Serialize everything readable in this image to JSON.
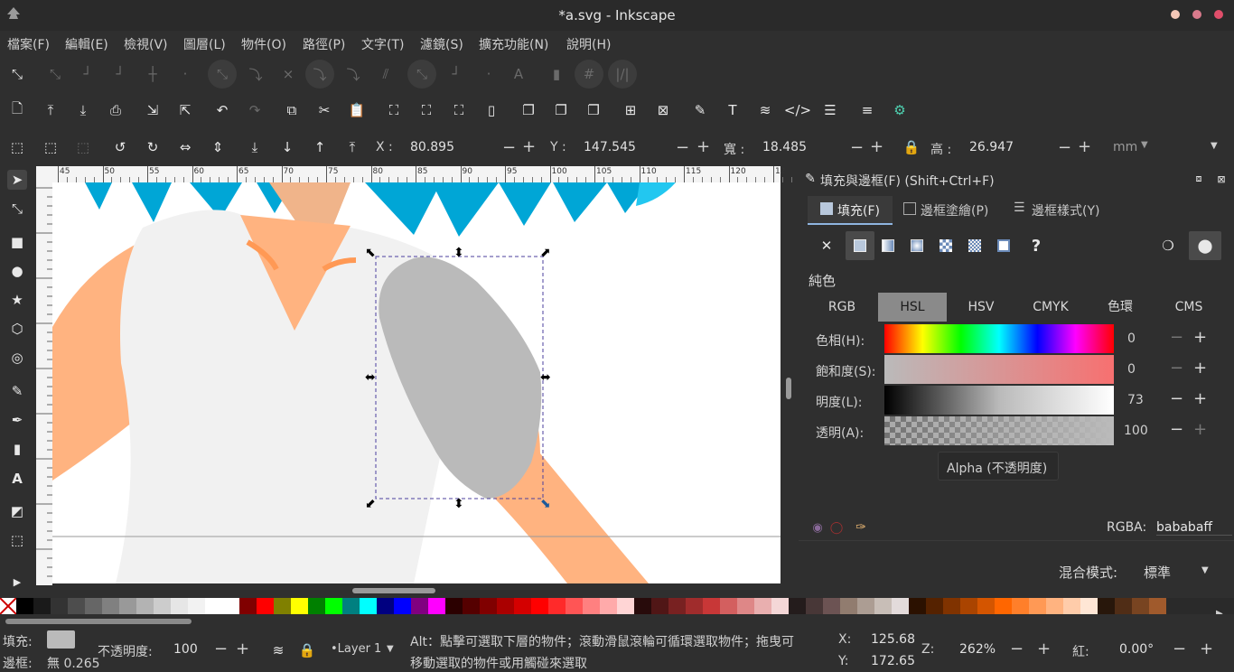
{
  "window": {
    "title": "*a.svg - Inkscape"
  },
  "menu": [
    "檔案(F)",
    "編輯(E)",
    "檢視(V)",
    "圖層(L)",
    "物件(O)",
    "路徑(P)",
    "文字(T)",
    "濾鏡(S)",
    "擴充功能(N)",
    "說明(H)"
  ],
  "toolbar": {
    "x_label": "X :",
    "x_value": "80.895",
    "y_label": "Y :",
    "y_value": "147.545",
    "w_label": "寬 :",
    "w_value": "18.485",
    "h_label": "高 :",
    "h_value": "26.947",
    "unit": "mm"
  },
  "ruler": {
    "ticks": [
      "45",
      "50",
      "55",
      "60",
      "65",
      "70",
      "75",
      "80",
      "85",
      "90",
      "95",
      "100",
      "105",
      "110",
      "115",
      "120",
      "12"
    ]
  },
  "panel": {
    "title": "填充與邊框(F) (Shift+Ctrl+F)",
    "tabs": [
      "填充(F)",
      "邊框塗繪(P)",
      "邊框樣式(Y)"
    ],
    "paint_type": "純色",
    "modes": [
      "RGB",
      "HSL",
      "HSV",
      "CMYK",
      "色環",
      "CMS"
    ],
    "active_mode": "HSL",
    "sliders": [
      {
        "label": "色相(H):",
        "value": "0"
      },
      {
        "label": "飽和度(S):",
        "value": "0"
      },
      {
        "label": "明度(L):",
        "value": "73"
      },
      {
        "label": "透明(A):",
        "value": "100"
      }
    ],
    "alpha_tooltip": "Alpha (不透明度)",
    "rgba_label": "RGBA:",
    "rgba_value": "bababaff",
    "blend_label": "混合模式:",
    "blend_value": "標準"
  },
  "status": {
    "fill_label": "填充:",
    "stroke_label": "邊框:",
    "stroke_value": "無 0.265",
    "opacity_label": "不透明度:",
    "opacity_value": "100",
    "layer": "•Layer 1",
    "message_line1": "Alt：點擊可選取下層的物件；滾動滑鼠滾輪可循環選取物件；拖曳可",
    "message_line2": "移動選取的物件或用觸碰來選取",
    "cx_label": "X:",
    "cx_value": "125.68",
    "cy_label": "Y:",
    "cy_value": "172.65",
    "zoom_label": "Z:",
    "zoom_value": "262%",
    "rot_label": "紅:",
    "rot_value": "0.00°"
  },
  "colors": {
    "accent": "#009fe3",
    "selected_fill": "#bababa",
    "skin": "#ffb380"
  },
  "palette": [
    "#000000",
    "#1a1a1a",
    "#333333",
    "#4d4d4d",
    "#666666",
    "#808080",
    "#999999",
    "#b3b3b3",
    "#cccccc",
    "#e6e6e6",
    "#f2f2f2",
    "#ffffff",
    "#ffffff",
    "#800000",
    "#ff0000",
    "#808000",
    "#ffff00",
    "#008000",
    "#00ff00",
    "#008080",
    "#00ffff",
    "#000080",
    "#0000ff",
    "#800080",
    "#ff00ff",
    "#2b0000",
    "#550000",
    "#800000",
    "#aa0000",
    "#d40000",
    "#ff0000",
    "#ff2a2a",
    "#ff5555",
    "#ff8080",
    "#ffaaaa",
    "#ffd5d5",
    "#280b0b",
    "#501616",
    "#782121",
    "#a02c2c",
    "#c83737",
    "#d35f5f",
    "#de8787",
    "#e9afaf",
    "#f4d7d7",
    "#241c1c",
    "#483737",
    "#6c5353",
    "#917c6f",
    "#ac9d93",
    "#c8beb7",
    "#e3dbdb",
    "#2b1100",
    "#552200",
    "#803300",
    "#aa4400",
    "#d45500",
    "#ff6600",
    "#ff7f2a",
    "#ff9955",
    "#ffb380",
    "#ffccaa",
    "#ffe6d5",
    "#28170b",
    "#502d16",
    "#784421",
    "#a05a2c"
  ]
}
